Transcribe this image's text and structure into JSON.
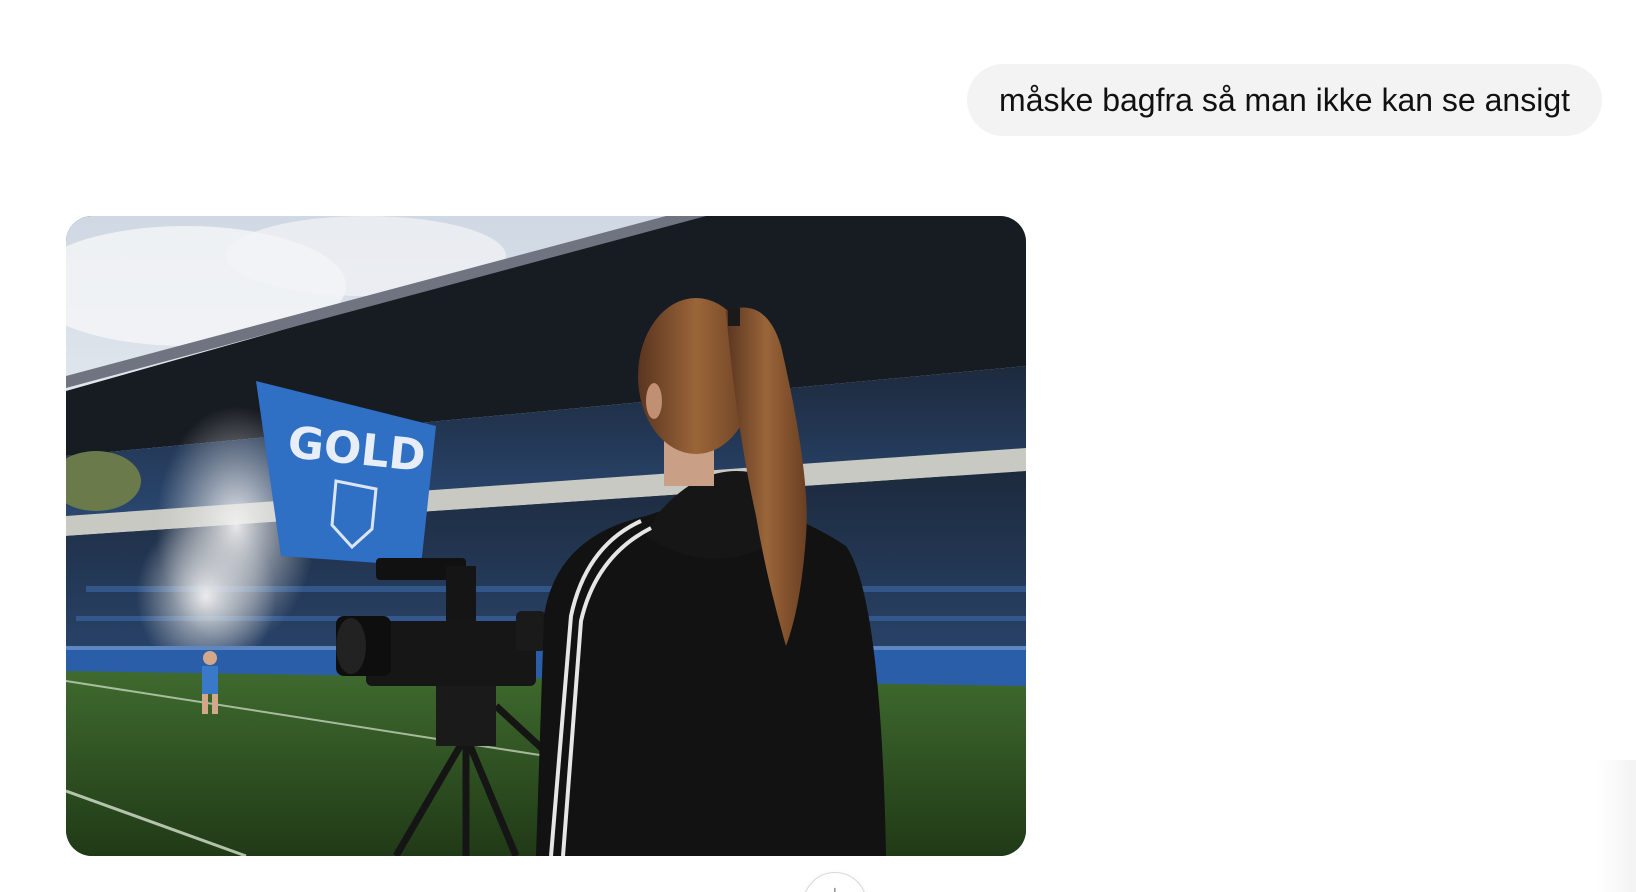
{
  "conversation": {
    "user_message": "måske bagfra så man ikke kan se ansigt",
    "generated_image": {
      "flag_text": "GOLD",
      "flag_color": "#2f6fc4"
    },
    "scroll_button": {
      "icon": "arrow-down-icon",
      "glyph": "↓"
    }
  }
}
